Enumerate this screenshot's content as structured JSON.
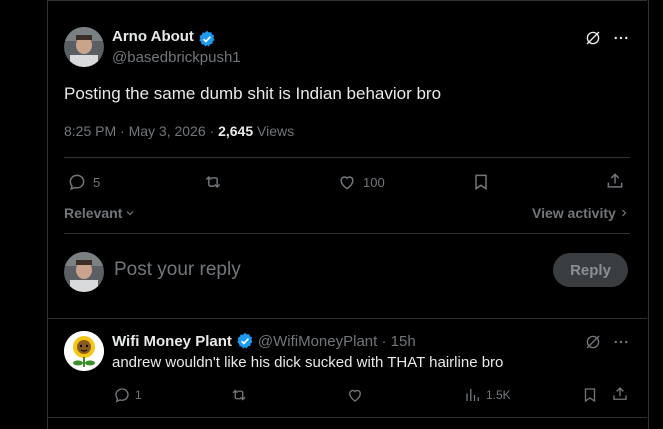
{
  "post": {
    "author_name": "Arno About",
    "author_handle": "@basedbrickpush1",
    "text": "Posting the same dumb shit is Indian behavior bro",
    "time": "8:25 PM · May 3, 2026 · ",
    "views_count": "2,645",
    "views_label": "Views",
    "replies": "5",
    "likes": "100"
  },
  "filters": {
    "sort": "Relevant",
    "view_activity": "View activity"
  },
  "composer": {
    "placeholder": "Post your reply",
    "reply_button": "Reply"
  },
  "reply": {
    "author_name": "Wifi Money Plant",
    "handle_time": "@WifiMoneyPlant · 15h",
    "text": "andrew wouldn't like his dick sucked with THAT hairline bro",
    "replies": "1",
    "views": "1.5K"
  },
  "colors": {
    "verified": "#1d9bf0",
    "background": "#000000",
    "border": "#2f3336",
    "muted": "#71767b"
  },
  "icons": [
    "verified-badge-icon",
    "grok-icon",
    "more-icon",
    "reply-icon",
    "repost-icon",
    "like-icon",
    "bookmark-icon",
    "share-icon",
    "chevron-down-icon",
    "chevron-right-icon",
    "views-icon"
  ]
}
